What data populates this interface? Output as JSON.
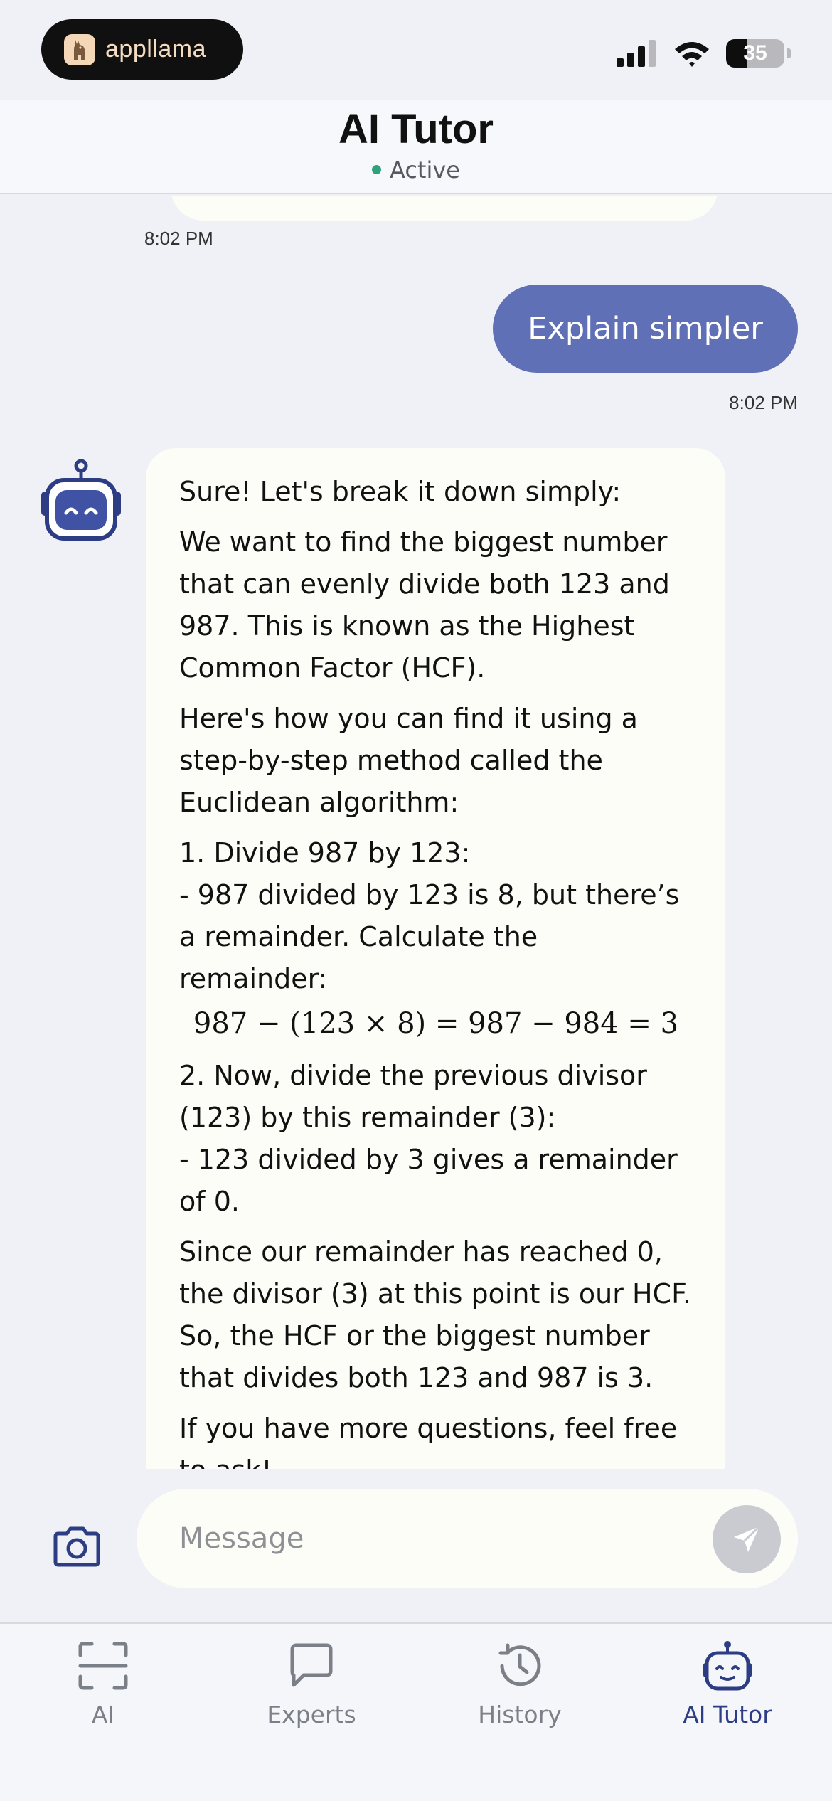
{
  "status_bar": {
    "brand": "appllama",
    "battery": "35"
  },
  "header": {
    "title": "AI Tutor",
    "status": "Active"
  },
  "chat": {
    "previous_timestamp": "8:02 PM",
    "user_message": {
      "text": "Explain simpler",
      "timestamp": "8:02 PM"
    },
    "bot_message": {
      "p1": "Sure! Let's break it down simply:",
      "p2": "We want to find the biggest number that can evenly divide both 123 and 987. This is known as the Highest Common Factor (HCF).",
      "p3": "Here's how you can find it using a step-by-step method called the Euclidean algorithm:",
      "step1_title": "1. Divide 987 by 123:",
      "step1_detail": "- 987 divided by 123 is 8, but there’s a remainder. Calculate the remainder:",
      "math": "987 − (123 × 8) = 987 − 984 = 3",
      "step2_title": "2. Now, divide the previous divisor (123) by this remainder (3):",
      "step2_detail": "- 123 divided by 3 gives a remainder of 0.",
      "p4": "Since our remainder has reached 0, the divisor (3) at this point is our HCF.",
      "p5": "So, the HCF or the biggest number that divides both 123 and 987 is 3.",
      "p6": "If you have more questions, feel free to ask!"
    }
  },
  "composer": {
    "placeholder": "Message"
  },
  "tabs": [
    {
      "label": "AI",
      "icon": "scan-icon"
    },
    {
      "label": "Experts",
      "icon": "chat-bubble-icon"
    },
    {
      "label": "History",
      "icon": "history-clock-icon"
    },
    {
      "label": "AI Tutor",
      "icon": "robot-icon",
      "active": true
    }
  ],
  "colors": {
    "background": "#eff1f7",
    "user_bubble": "#5f70b6",
    "bot_bubble": "#fdfdf8",
    "accent": "#2d3d84",
    "active_dot": "#2fa27a"
  }
}
